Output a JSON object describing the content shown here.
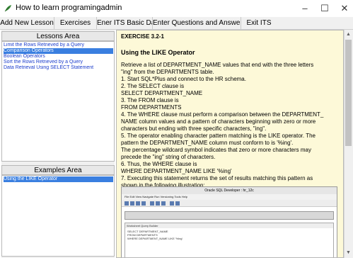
{
  "window": {
    "title": "How to learn programingadmin",
    "min_glyph": "–",
    "max_glyph": "☐",
    "close_glyph": "✕"
  },
  "menu": [
    "Add New Lesson",
    "Exercises",
    "Ener ITS Basic Data",
    "Enter Questions and Answers",
    "Exit ITS"
  ],
  "lessons": {
    "header": "Lessons Area",
    "items": [
      "Limit the Rows Retrieved by a Query",
      "Comparison Operators",
      "Boolean Operators",
      "Sort the Rows Retrieved by a Query",
      "Data Retrieval Using SELECT Statement"
    ],
    "selected_index": 1
  },
  "examples": {
    "header": "Examples Area",
    "items": [
      "Using the LIKE Operator"
    ],
    "selected_index": 0
  },
  "content": {
    "exercise_heading": "EXERCISE 3.2-1",
    "sub_heading": "Using the LIKE Operator",
    "lines": [
      "Retrieve a list of DEPARTMENT_NAME values that end with the three letters",
      "\"ing\" from the DEPARTMENTS table.",
      "1. Start SQL*Plus and connect to the HR schema.",
      "2. The SELECT clause is",
      "SELECT DEPARTMENT_NAME",
      "3. The FROM clause is",
      "FROM DEPARTMENTS",
      "4. The WHERE clause must perform a comparison between the DEPARTMENT_",
      "NAME column values and a pattern of characters beginning with zero or more",
      "characters but ending with three specific characters, \"ing\".",
      "5. The operator enabling character pattern matching is the LIKE operator. The",
      "pattern the DEPARTMENT_NAME column must conform to is '%ing'.",
      "The percentage wildcard symbol indicates that zero or more characters may",
      "precede the \"ing\" string of characters.",
      "6. Thus, the WHERE clause is",
      "WHERE DEPARTMENT_NAME LIKE '%ing'",
      "7. Executing this statement returns the set of results matching this pattern as",
      "shown in the following illustration:"
    ]
  },
  "illustration": {
    "title": "Oracle SQL Developer : hr_12c",
    "menu": "File  Edit  View  Navigate  Run  Versioning  Tools  Help",
    "result_header": "Worksheet   Query Builder",
    "sql": "SELECT DEPARTMENT_NAME\nFROM DEPARTMENTS\nWHERE DEPARTMENT_NAME LIKE '%ing'"
  },
  "icons": {
    "app": "feather-app-icon",
    "scroll_up": "chevron-up-icon",
    "scroll_down": "chevron-down-icon"
  },
  "colors": {
    "content_bg": "#fdf9d8",
    "selection": "#3a7fe0",
    "link": "#1a3ccc"
  }
}
